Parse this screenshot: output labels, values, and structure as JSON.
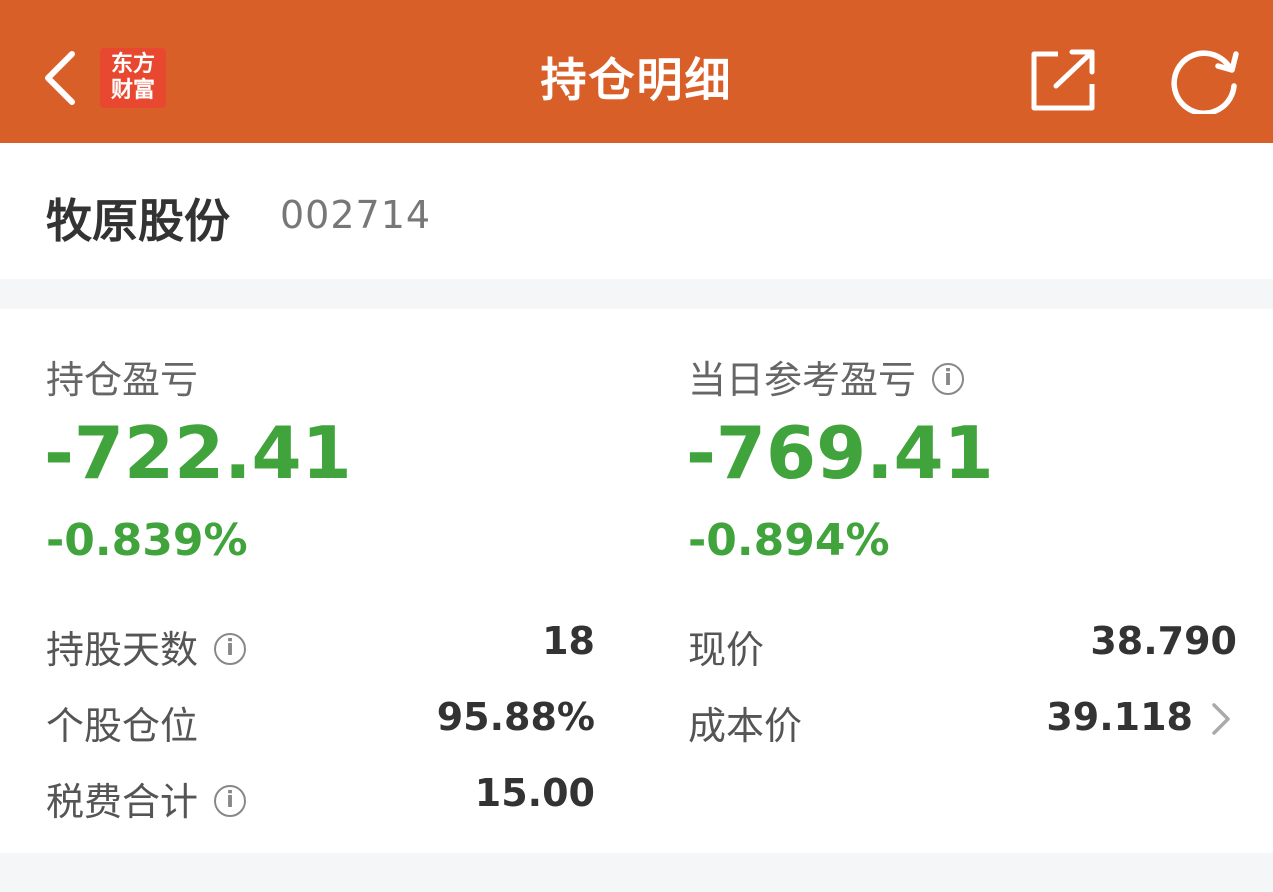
{
  "header": {
    "title": "持仓明细",
    "logo_line1": "东方",
    "logo_line2": "财富",
    "bg_color": "#d95f29",
    "icons": [
      "chevron-left-icon",
      "share-icon",
      "refresh-icon"
    ]
  },
  "stock": {
    "name": "牧原股份",
    "code": "002714"
  },
  "pnl": {
    "holding": {
      "label": "持仓盈亏",
      "value": "-722.41",
      "pct": "-0.839%"
    },
    "daily": {
      "label": "当日参考盈亏",
      "value": "-769.41",
      "pct": "-0.894%"
    },
    "loss_color": "#40a33c"
  },
  "details": {
    "left": [
      {
        "label": "持股天数",
        "value": "18"
      },
      {
        "label": "个股仓位",
        "value": "95.88%"
      },
      {
        "label": "税费合计",
        "value": "15.00"
      }
    ],
    "right": [
      {
        "label": "现价",
        "value": "38.790"
      },
      {
        "label": "成本价",
        "value": "39.118"
      }
    ]
  },
  "info_glyph": "i"
}
